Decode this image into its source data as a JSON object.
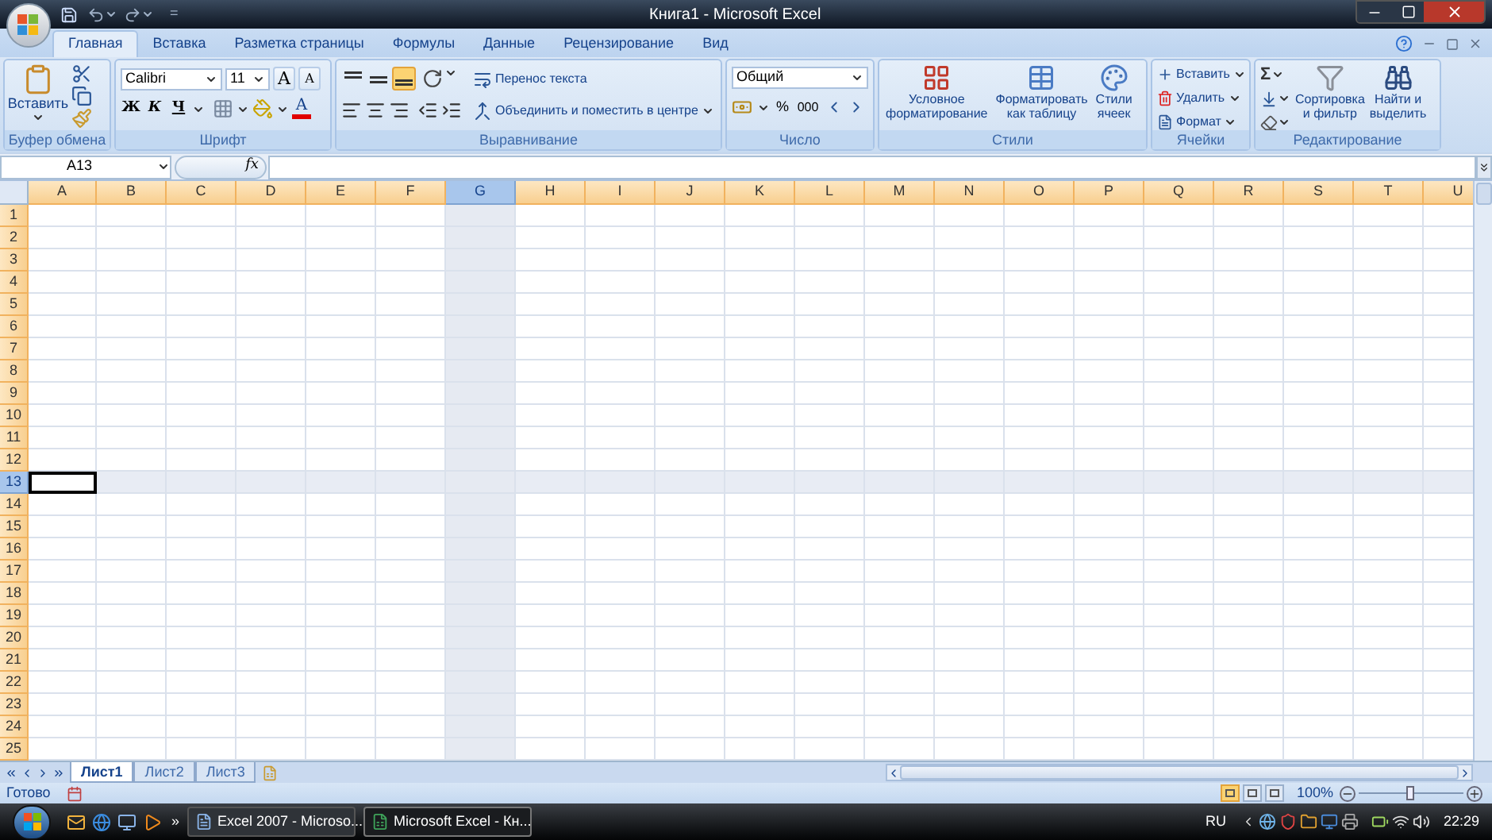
{
  "title_bar": {
    "title": "Книга1 - Microsoft Excel",
    "qat_menu": "="
  },
  "tabs": [
    {
      "label": "Главная",
      "selected": true
    },
    {
      "label": "Вставка",
      "selected": false
    },
    {
      "label": "Разметка страницы",
      "selected": false
    },
    {
      "label": "Формулы",
      "selected": false
    },
    {
      "label": "Данные",
      "selected": false
    },
    {
      "label": "Рецензирование",
      "selected": false
    },
    {
      "label": "Вид",
      "selected": false
    }
  ],
  "ribbon": {
    "clipboard": {
      "label": "Буфер обмена",
      "paste": "Вставить"
    },
    "font": {
      "label": "Шрифт",
      "font_name": "Calibri",
      "font_size": "11",
      "grow": "A",
      "shrink": "A",
      "bold": "Ж",
      "italic": "К",
      "underline": "Ч",
      "font_color": "A"
    },
    "alignment": {
      "label": "Выравнивание",
      "wrap": "Перенос текста",
      "merge": "Объединить и поместить в центре",
      "vertical_align": [
        {
          "selected": false
        },
        {
          "selected": false
        },
        {
          "selected": true
        }
      ]
    },
    "number": {
      "label": "Число",
      "format": "Общий",
      "percent": "%",
      "thousands": "000"
    },
    "styles": {
      "label": "Стили",
      "buttons": [
        {
          "lines": [
            "Условное",
            "форматирование"
          ]
        },
        {
          "lines": [
            "Форматировать",
            "как таблицу"
          ]
        },
        {
          "lines": [
            "Стили",
            "ячеек"
          ]
        }
      ]
    },
    "cells": {
      "label": "Ячейки",
      "buttons": [
        "Вставить",
        "Удалить",
        "Формат"
      ]
    },
    "editing": {
      "label": "Редактирование",
      "sigma": "Σ",
      "sort": [
        "Сортировка",
        "и фильтр"
      ],
      "find": [
        "Найти и",
        "выделить"
      ]
    }
  },
  "formula_bar": {
    "name_box": "A13",
    "fx": "fx"
  },
  "columns": [
    {
      "label": "A",
      "selected": false,
      "active": true
    },
    {
      "label": "B",
      "selected": false,
      "active": false
    },
    {
      "label": "C",
      "selected": false,
      "active": false
    },
    {
      "label": "D",
      "selected": false,
      "active": false
    },
    {
      "label": "E",
      "selected": false,
      "active": false
    },
    {
      "label": "F",
      "selected": false,
      "active": false
    },
    {
      "label": "G",
      "selected": true,
      "active": false
    },
    {
      "label": "H",
      "selected": false,
      "active": false
    },
    {
      "label": "I",
      "selected": false,
      "active": false
    },
    {
      "label": "J",
      "selected": false,
      "active": false
    },
    {
      "label": "K",
      "selected": false,
      "active": false
    },
    {
      "label": "L",
      "selected": false,
      "active": false
    },
    {
      "label": "M",
      "selected": false,
      "active": false
    },
    {
      "label": "N",
      "selected": false,
      "active": false
    },
    {
      "label": "O",
      "selected": false,
      "active": false
    },
    {
      "label": "P",
      "selected": false,
      "active": false
    },
    {
      "label": "Q",
      "selected": false,
      "active": false
    },
    {
      "label": "R",
      "selected": false,
      "active": false
    },
    {
      "label": "S",
      "selected": false,
      "active": false
    },
    {
      "label": "T",
      "selected": false,
      "active": false
    },
    {
      "label": "U",
      "selected": false,
      "active": false
    }
  ],
  "rows": [
    {
      "label": "1",
      "selected": false
    },
    {
      "label": "2",
      "selected": false
    },
    {
      "label": "3",
      "selected": false
    },
    {
      "label": "4",
      "selected": false
    },
    {
      "label": "5",
      "selected": false
    },
    {
      "label": "6",
      "selected": false
    },
    {
      "label": "7",
      "selected": false
    },
    {
      "label": "8",
      "selected": false
    },
    {
      "label": "9",
      "selected": false
    },
    {
      "label": "10",
      "selected": false
    },
    {
      "label": "11",
      "selected": false
    },
    {
      "label": "12",
      "selected": false
    },
    {
      "label": "13",
      "selected": true
    },
    {
      "label": "14",
      "selected": false
    },
    {
      "label": "15",
      "selected": false
    },
    {
      "label": "16",
      "selected": false
    },
    {
      "label": "17",
      "selected": false
    },
    {
      "label": "18",
      "selected": false
    },
    {
      "label": "19",
      "selected": false
    },
    {
      "label": "20",
      "selected": false
    },
    {
      "label": "21",
      "selected": false
    },
    {
      "label": "22",
      "selected": false
    },
    {
      "label": "23",
      "selected": false
    },
    {
      "label": "24",
      "selected": false
    },
    {
      "label": "25",
      "selected": false
    }
  ],
  "sheet_tabs": [
    {
      "label": "Лист1",
      "selected": true
    },
    {
      "label": "Лист2",
      "selected": false
    },
    {
      "label": "Лист3",
      "selected": false
    }
  ],
  "status_bar": {
    "status": "Готово",
    "view_buttons": [
      {
        "selected": true
      },
      {
        "selected": false
      },
      {
        "selected": false
      }
    ],
    "zoom": "100%",
    "zoom_slider": {
      "level": 0.5
    }
  },
  "taskbar": {
    "more": "»",
    "windows": [
      {
        "label": "Excel 2007 - Microso...",
        "selected": false
      },
      {
        "label": "Microsoft Excel - Кн...",
        "selected": true
      }
    ],
    "language": "RU",
    "clock": "22:29"
  }
}
